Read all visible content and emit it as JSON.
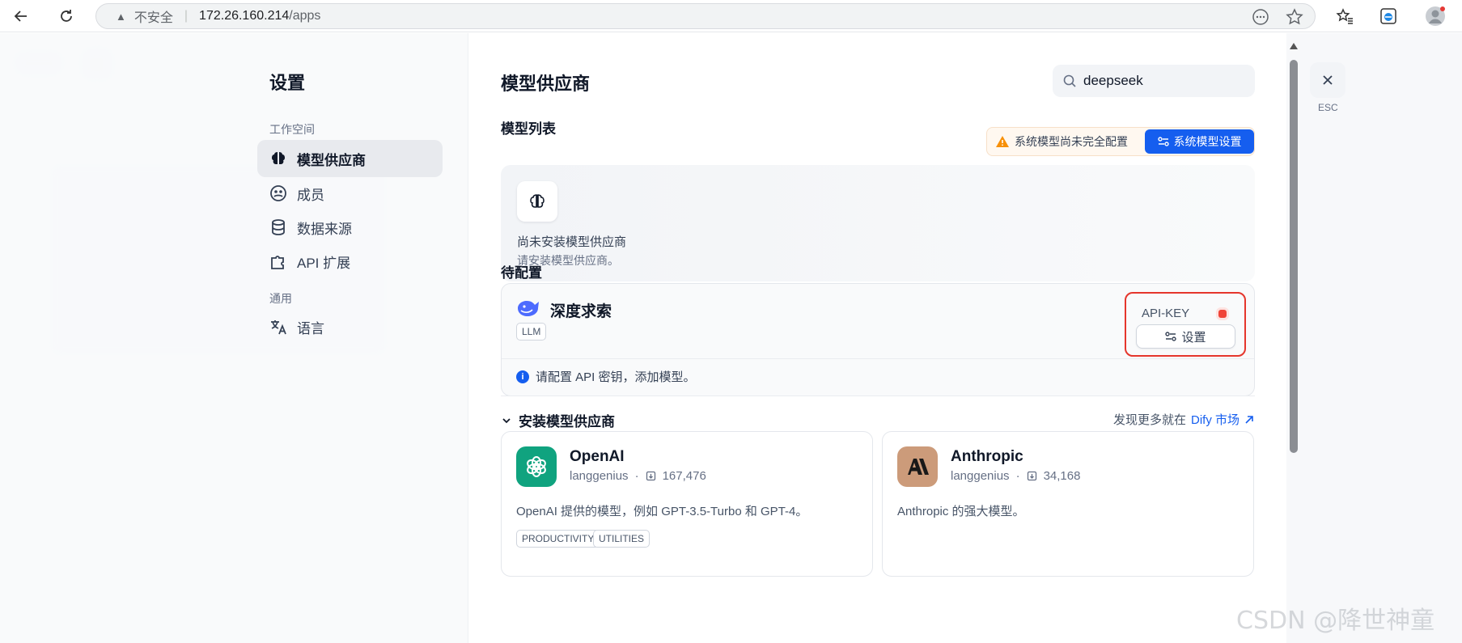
{
  "browser": {
    "security_text": "不安全",
    "url_host": "172.26.160.214",
    "url_path": "/apps"
  },
  "settings": {
    "title": "设置",
    "workspace_label": "工作空间",
    "general_label": "通用",
    "nav": [
      {
        "label": "模型供应商",
        "icon": "brain-icon",
        "active": true
      },
      {
        "label": "成员",
        "icon": "members-icon"
      },
      {
        "label": "数据来源",
        "icon": "database-icon"
      },
      {
        "label": "API 扩展",
        "icon": "puzzle-icon"
      },
      {
        "label": "语言",
        "icon": "translate-icon"
      }
    ]
  },
  "panel": {
    "title": "模型供应商",
    "search_value": "deepseek",
    "model_list_title": "模型列表",
    "warning_text": "系统模型尚未完全配置",
    "system_settings_label": "系统模型设置",
    "empty_title": "尚未安装模型供应商",
    "empty_desc": "请安装模型供应商。",
    "pending_title": "待配置",
    "provider": {
      "name": "深度求索",
      "tag": "LLM",
      "api_key_label": "API-KEY",
      "settings_button": "设置",
      "info": "请配置 API 密钥，添加模型。"
    },
    "install_title": "安装模型供应商",
    "discover_prefix": "发现更多就在",
    "discover_link": "Dify 市场",
    "market": [
      {
        "name": "OpenAI",
        "author": "langgenius",
        "installs": "167,476",
        "desc": "OpenAI 提供的模型，例如 GPT-3.5-Turbo 和 GPT-4。",
        "tags": [
          "PRODUCTIVITY",
          "UTILITIES"
        ],
        "color": "#10a37f"
      },
      {
        "name": "Anthropic",
        "author": "langgenius",
        "installs": "34,168",
        "desc": "Anthropic 的强大模型。",
        "tags": [],
        "color": "#cc9b7a"
      }
    ]
  },
  "close": {
    "esc_label": "ESC"
  },
  "watermark": "CSDN @降世神童",
  "colors": {
    "accent": "#155eef",
    "danger": "#e5362c"
  }
}
